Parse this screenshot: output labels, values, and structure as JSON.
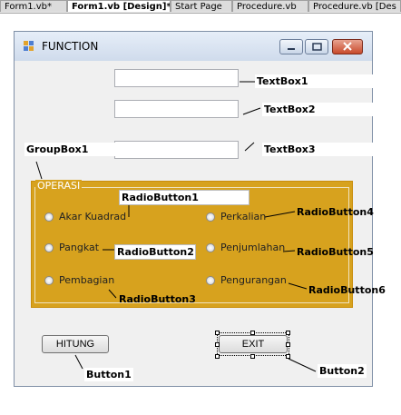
{
  "tabs": [
    {
      "label": "Form1.vb*"
    },
    {
      "label": "Form1.vb [Design]*"
    },
    {
      "label": "Start Page"
    },
    {
      "label": "Procedure.vb"
    },
    {
      "label": "Procedure.vb [Des"
    }
  ],
  "window": {
    "title": "FUNCTION"
  },
  "annotations": {
    "textbox1": "TextBox1",
    "textbox2": "TextBox2",
    "textbox3": "TextBox3",
    "groupbox1": "GroupBox1",
    "radio1": "RadioButton1",
    "radio2": "RadioButton2",
    "radio3": "RadioButton3",
    "radio4": "RadioButton4",
    "radio5": "RadioButton5",
    "radio6": "RadioButton6",
    "button1": "Button1",
    "button2": "Button2"
  },
  "group": {
    "title": "OPERASI"
  },
  "radios": {
    "akar_kuadrad": "Akar Kuadrad",
    "pangkat": "Pangkat",
    "pembagian": "Pembagian",
    "perkalian": "Perkalian",
    "penjumlahan": "Penjumlahan",
    "pengurangan": "Pengurangan"
  },
  "buttons": {
    "hitung": "HITUNG",
    "exit": "EXIT"
  },
  "colors": {
    "group_background": "#d7a21e",
    "titlebar": "#cfdbec",
    "close_button": "#c84a2b"
  }
}
